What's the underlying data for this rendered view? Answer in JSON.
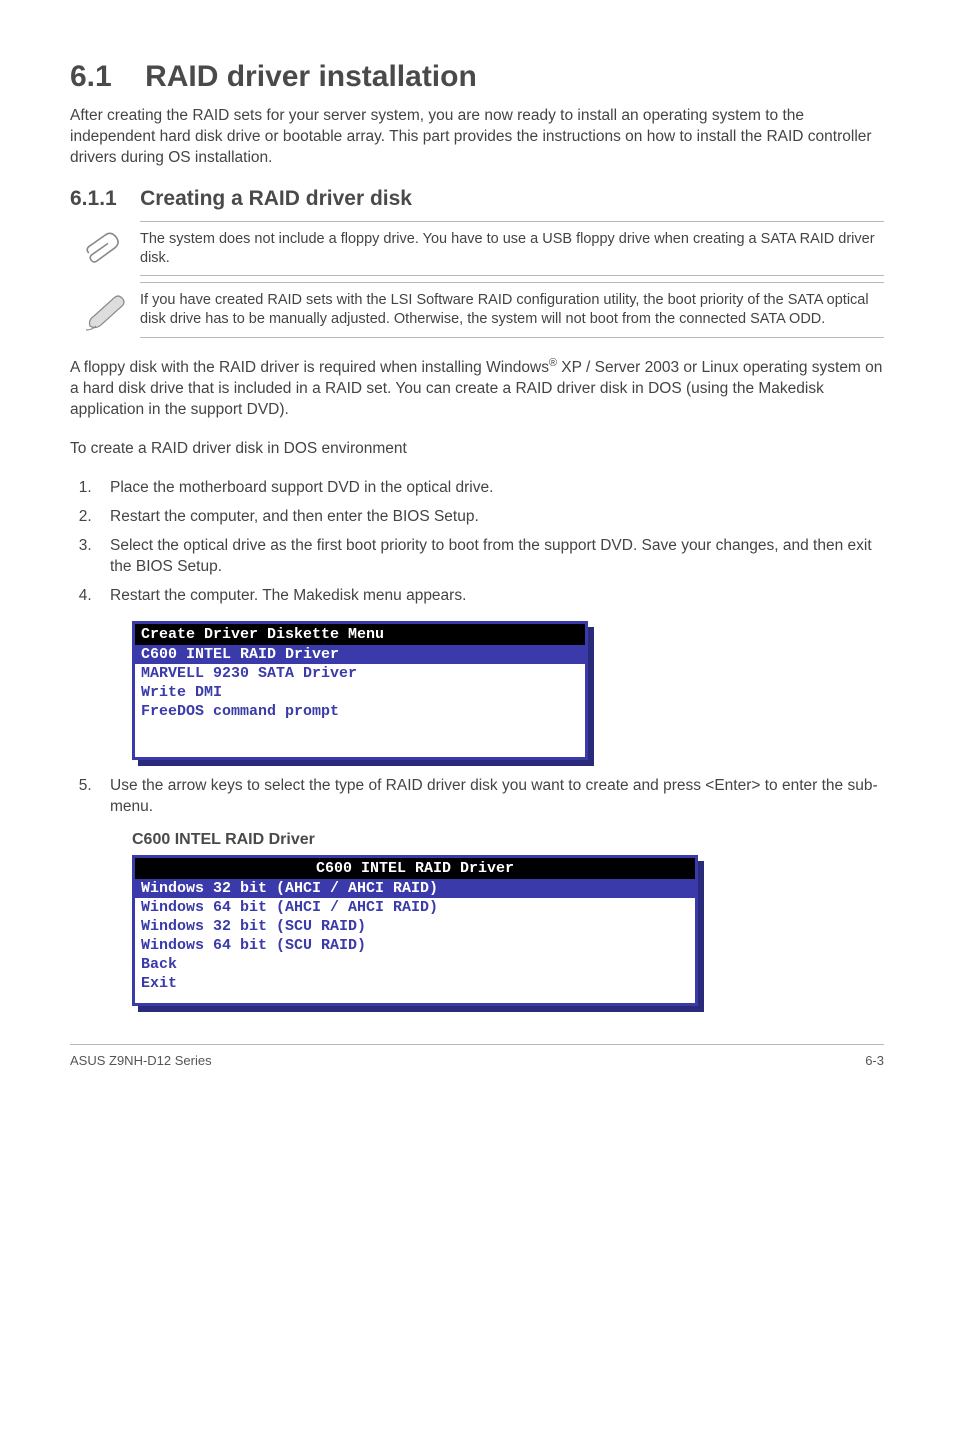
{
  "section": {
    "number": "6.1",
    "title": "RAID driver installation",
    "intro": "After creating the RAID sets for your server system, you are now ready to install an operating system to the independent hard disk drive or bootable array. This part provides the instructions on how to install the RAID controller drivers during OS installation."
  },
  "subsection": {
    "number": "6.1.1",
    "title": "Creating a RAID driver disk"
  },
  "note1": "The system does not include a floppy drive. You have to use a USB floppy drive when creating a SATA RAID driver disk.",
  "note2": "If you have created RAID sets with the LSI Software RAID configuration utility, the boot priority of the SATA optical disk drive has to be manually adjusted. Otherwise, the system will not boot from the connected SATA ODD.",
  "para2_pre": "A floppy disk with the RAID driver is required when installing Windows",
  "para2_post": " XP / Server 2003 or Linux operating system on a hard disk drive that is included in a RAID set. You can create a RAID driver disk in DOS (using the Makedisk application in the support DVD).",
  "para3": "To create a RAID driver disk in DOS environment",
  "steps": [
    "Place the motherboard support DVD in the optical drive.",
    "Restart the computer, and then enter the BIOS Setup.",
    "Select the optical drive as the first boot priority to boot from the support DVD. Save your changes, and then exit the BIOS Setup.",
    "Restart the computer. The Makedisk menu appears."
  ],
  "menu1": {
    "header": "Create Driver Diskette Menu",
    "selected": "C600 INTEL RAID Driver",
    "options": [
      "MARVELL 9230 SATA Driver",
      "Write DMI",
      "FreeDOS command prompt"
    ]
  },
  "step5": "Use the arrow keys to select the type of RAID driver disk you want to create and press <Enter> to enter the sub-menu.",
  "driver_title": "C600 INTEL RAID Driver",
  "menu2": {
    "header": "C600 INTEL RAID Driver",
    "selected": "Windows 32 bit (AHCI / AHCI RAID)",
    "options": [
      "Windows 64 bit (AHCI / AHCI RAID)",
      "Windows 32 bit (SCU RAID)",
      "Windows 64 bit (SCU RAID)",
      "Back",
      "Exit"
    ]
  },
  "footer": {
    "left": "ASUS Z9NH-D12 Series",
    "right": "6-3"
  }
}
